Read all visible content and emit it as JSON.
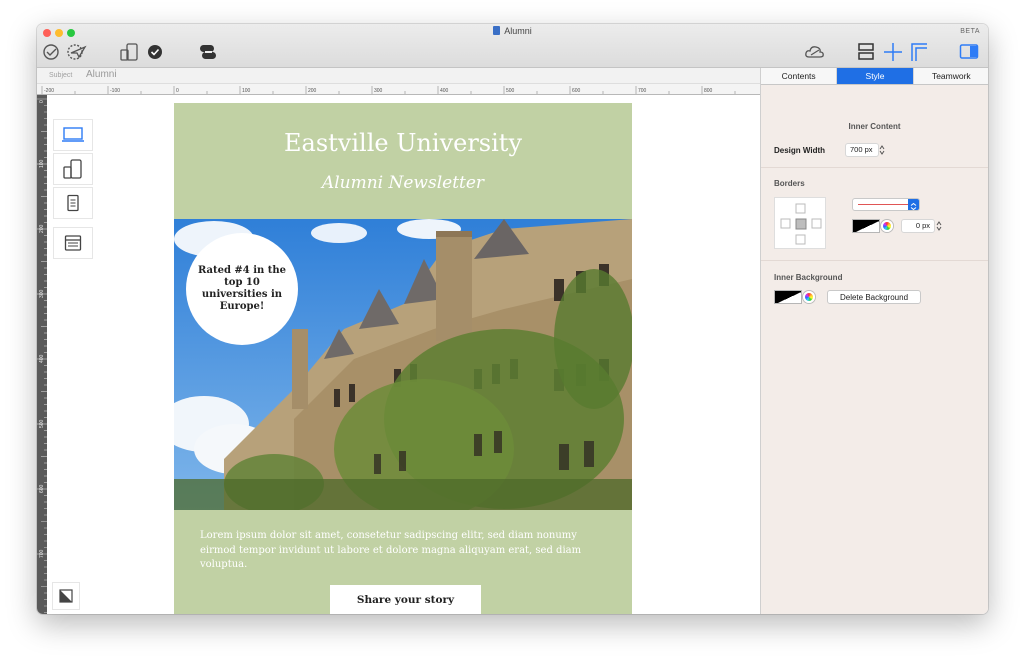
{
  "window": {
    "title": "Alumni",
    "beta_label": "BETA",
    "traffic_colors": {
      "close": "#fe5f57",
      "minimize": "#febc2e",
      "zoom": "#28c840"
    }
  },
  "toolbar": {
    "left_icons": [
      "preview-send-icon",
      "send-test-icon",
      "device-preview-icon",
      "check-icon",
      "link-icon"
    ],
    "right_icons": [
      "cloud-icon",
      "layout-icon",
      "grid-guides-icon",
      "margins-icon",
      "sidebar-toggle-icon"
    ]
  },
  "subject": {
    "label": "Subject",
    "value": "Alumni"
  },
  "ruler": {
    "h_labels": [
      "-200",
      "-100",
      "0",
      "100",
      "200",
      "300",
      "400",
      "500",
      "600",
      "700",
      "800"
    ],
    "v_labels": [
      "0",
      "100",
      "200",
      "300",
      "400",
      "500",
      "600",
      "700"
    ]
  },
  "devices": [
    "desktop-icon",
    "mobile-tablet-icon",
    "tablet-icon",
    "browser-icon"
  ],
  "email": {
    "title": "Eastville University",
    "subtitle": "Alumni Newsletter",
    "badge_text": "Rated #4 in the top 10 universities in Europe!",
    "body_text": "Lorem ipsum dolor sit amet, consetetur sadipscing elitr, sed diam nonumy eirmod tempor invidunt ut labore et dolore magna aliquyam erat, sed diam voluptua.",
    "cta_label": "Share your story",
    "background_color": "#c1d1a4"
  },
  "sidebar": {
    "tabs": [
      {
        "label": "Contents",
        "active": false
      },
      {
        "label": "Style",
        "active": true
      },
      {
        "label": "Teamwork",
        "active": false
      }
    ],
    "section_title": "Inner Content",
    "design_width_label": "Design Width",
    "design_width_value": "700 px",
    "borders_label": "Borders",
    "border_width_value": "0 px",
    "inner_background_label": "Inner Background",
    "delete_background_label": "Delete Background",
    "accent_color": "#1f6fe5"
  }
}
